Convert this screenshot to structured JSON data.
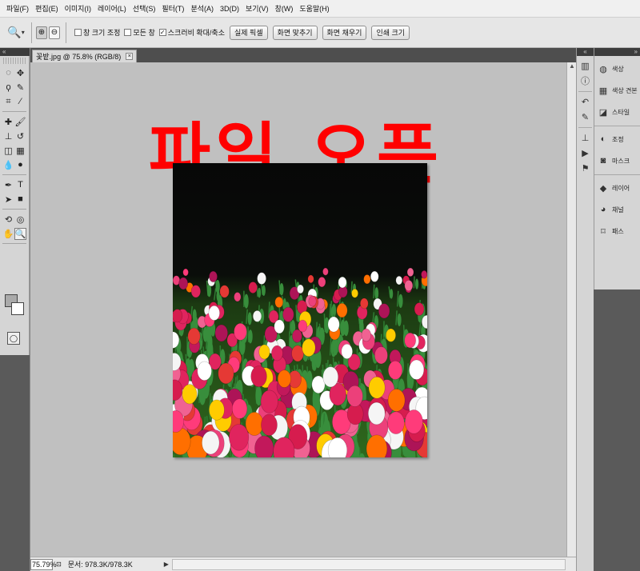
{
  "menu": [
    "파일(F)",
    "편집(E)",
    "이미지(I)",
    "레이어(L)",
    "선택(S)",
    "필터(T)",
    "분석(A)",
    "3D(D)",
    "보기(V)",
    "창(W)",
    "도움말(H)"
  ],
  "options": {
    "resize_window": "창 크기 조정",
    "all_windows": "모든 창",
    "scrubby_zoom": "스크러비 확대/축소",
    "scrubby_checked": "✓",
    "actual_pixels": "실제 픽셀",
    "fit_screen": "화면 맞추기",
    "fill_screen": "화면 채우기",
    "print_size": "인쇄 크기"
  },
  "document": {
    "tab_title": "꽃밭.jpg @ 75.8% (RGB/8)",
    "overlay_text": "파일 오픈",
    "zoom": "75.79%",
    "doc_info": "문서: 978.3K/978.3K"
  },
  "right_panels": [
    {
      "label": "색상",
      "icon": "color-icon"
    },
    {
      "label": "색상 견본",
      "icon": "swatches-icon"
    },
    {
      "label": "스타일",
      "icon": "styles-icon"
    },
    {
      "label": "조정",
      "icon": "adjustments-icon"
    },
    {
      "label": "마스크",
      "icon": "masks-icon"
    },
    {
      "label": "레이어",
      "icon": "layers-icon"
    },
    {
      "label": "채널",
      "icon": "channels-icon"
    },
    {
      "label": "패스",
      "icon": "paths-icon"
    }
  ],
  "colors": {
    "foreground": "#aaaaaa",
    "background": "#ffffff",
    "overlay": "#ff0000"
  }
}
